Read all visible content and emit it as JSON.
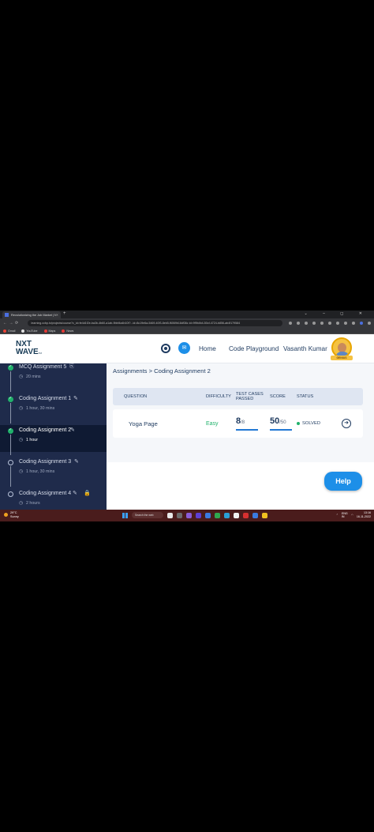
{
  "browser": {
    "tab_title": "Revolutionizing the Job Market | NxtWave",
    "tab_close": "✕",
    "new_tab": "+",
    "window_controls": "⌄ – ◻ ✕",
    "nav": {
      "back": "←",
      "forward": "→",
      "reload": "⟳"
    },
    "url": "learning.ccbp.in/projects/course?c_id=fe4d1f2e-ba3b-4b60-a1ab-9bbf4a4b10f?...id=8c19e6a-5469-40f3-8eb5-f6069b18df36c id=9f9b4b4-50cf-4724-b856-ab4f179584",
    "bookmarks": [
      {
        "label": "Gmail",
        "color": "#ea4335"
      },
      {
        "label": "YouTube",
        "color": "#e0e0e0"
      },
      {
        "label": "Maps",
        "color": "#e53935"
      },
      {
        "label": "News",
        "color": "#e53935"
      }
    ]
  },
  "header": {
    "logo_line1": "NXT",
    "logo_line2": "WAVE",
    "logo_tm": "TM",
    "chat_icon": "✉",
    "nav_home": "Home",
    "nav_code_playground": "Code Playground",
    "user_name": "Vasanth Kumar",
    "badge": "GENIUS"
  },
  "sidebar": {
    "items": [
      {
        "name": "MCQ Assignment 5",
        "duration": "20 mins",
        "state": "done",
        "icon": "clipboard-icon",
        "glyph": "⎘"
      },
      {
        "name": "Coding Assignment 1",
        "duration": "1 hour, 30 mins",
        "state": "done",
        "icon": "edit-icon",
        "glyph": "✎"
      },
      {
        "name": "Coding Assignment 2",
        "duration": "1 hour",
        "state": "active",
        "icon": "edit-icon",
        "glyph": "✎"
      },
      {
        "name": "Coding Assignment 3",
        "duration": "1 hour, 30 mins",
        "state": "todo",
        "icon": "edit-icon",
        "glyph": "✎"
      },
      {
        "name": "Coding Assignment 4",
        "duration": "2 hours",
        "state": "todo",
        "icon": "edit-icon",
        "glyph": "✎"
      }
    ],
    "clock_glyph": "◷"
  },
  "main": {
    "breadcrumb": "Assignments > Coding Assignment 2",
    "columns": {
      "question": "QUESTION",
      "difficulty": "DIFFICULTY",
      "test_cases_1": "TEST CASES",
      "test_cases_2": "PASSED",
      "score": "SCORE",
      "status": "STATUS"
    },
    "row": {
      "question": "Yoga Page",
      "difficulty": "Easy",
      "test_passed": "8",
      "test_total": "/8",
      "test_progress": 1.0,
      "score": "50",
      "score_total": "/50",
      "score_progress": 1.0,
      "status": "SOLVED",
      "open_glyph": "➜"
    },
    "help_label": "Help"
  },
  "taskbar": {
    "temp": "29°C",
    "weather": "Sunny",
    "search_label": "Search the web",
    "app_colors": [
      "#e8e8e8",
      "#6a6a6a",
      "#8a5cd6",
      "#5d3fd3",
      "#3a7be0",
      "#2fa84f",
      "#2a9fd6",
      "#f0f0f0",
      "#d63030",
      "#3a7be0",
      "#f0c020"
    ],
    "lang_1": "ENG",
    "lang_2": "IN",
    "time": "13:16",
    "date": "16-11-2022"
  }
}
